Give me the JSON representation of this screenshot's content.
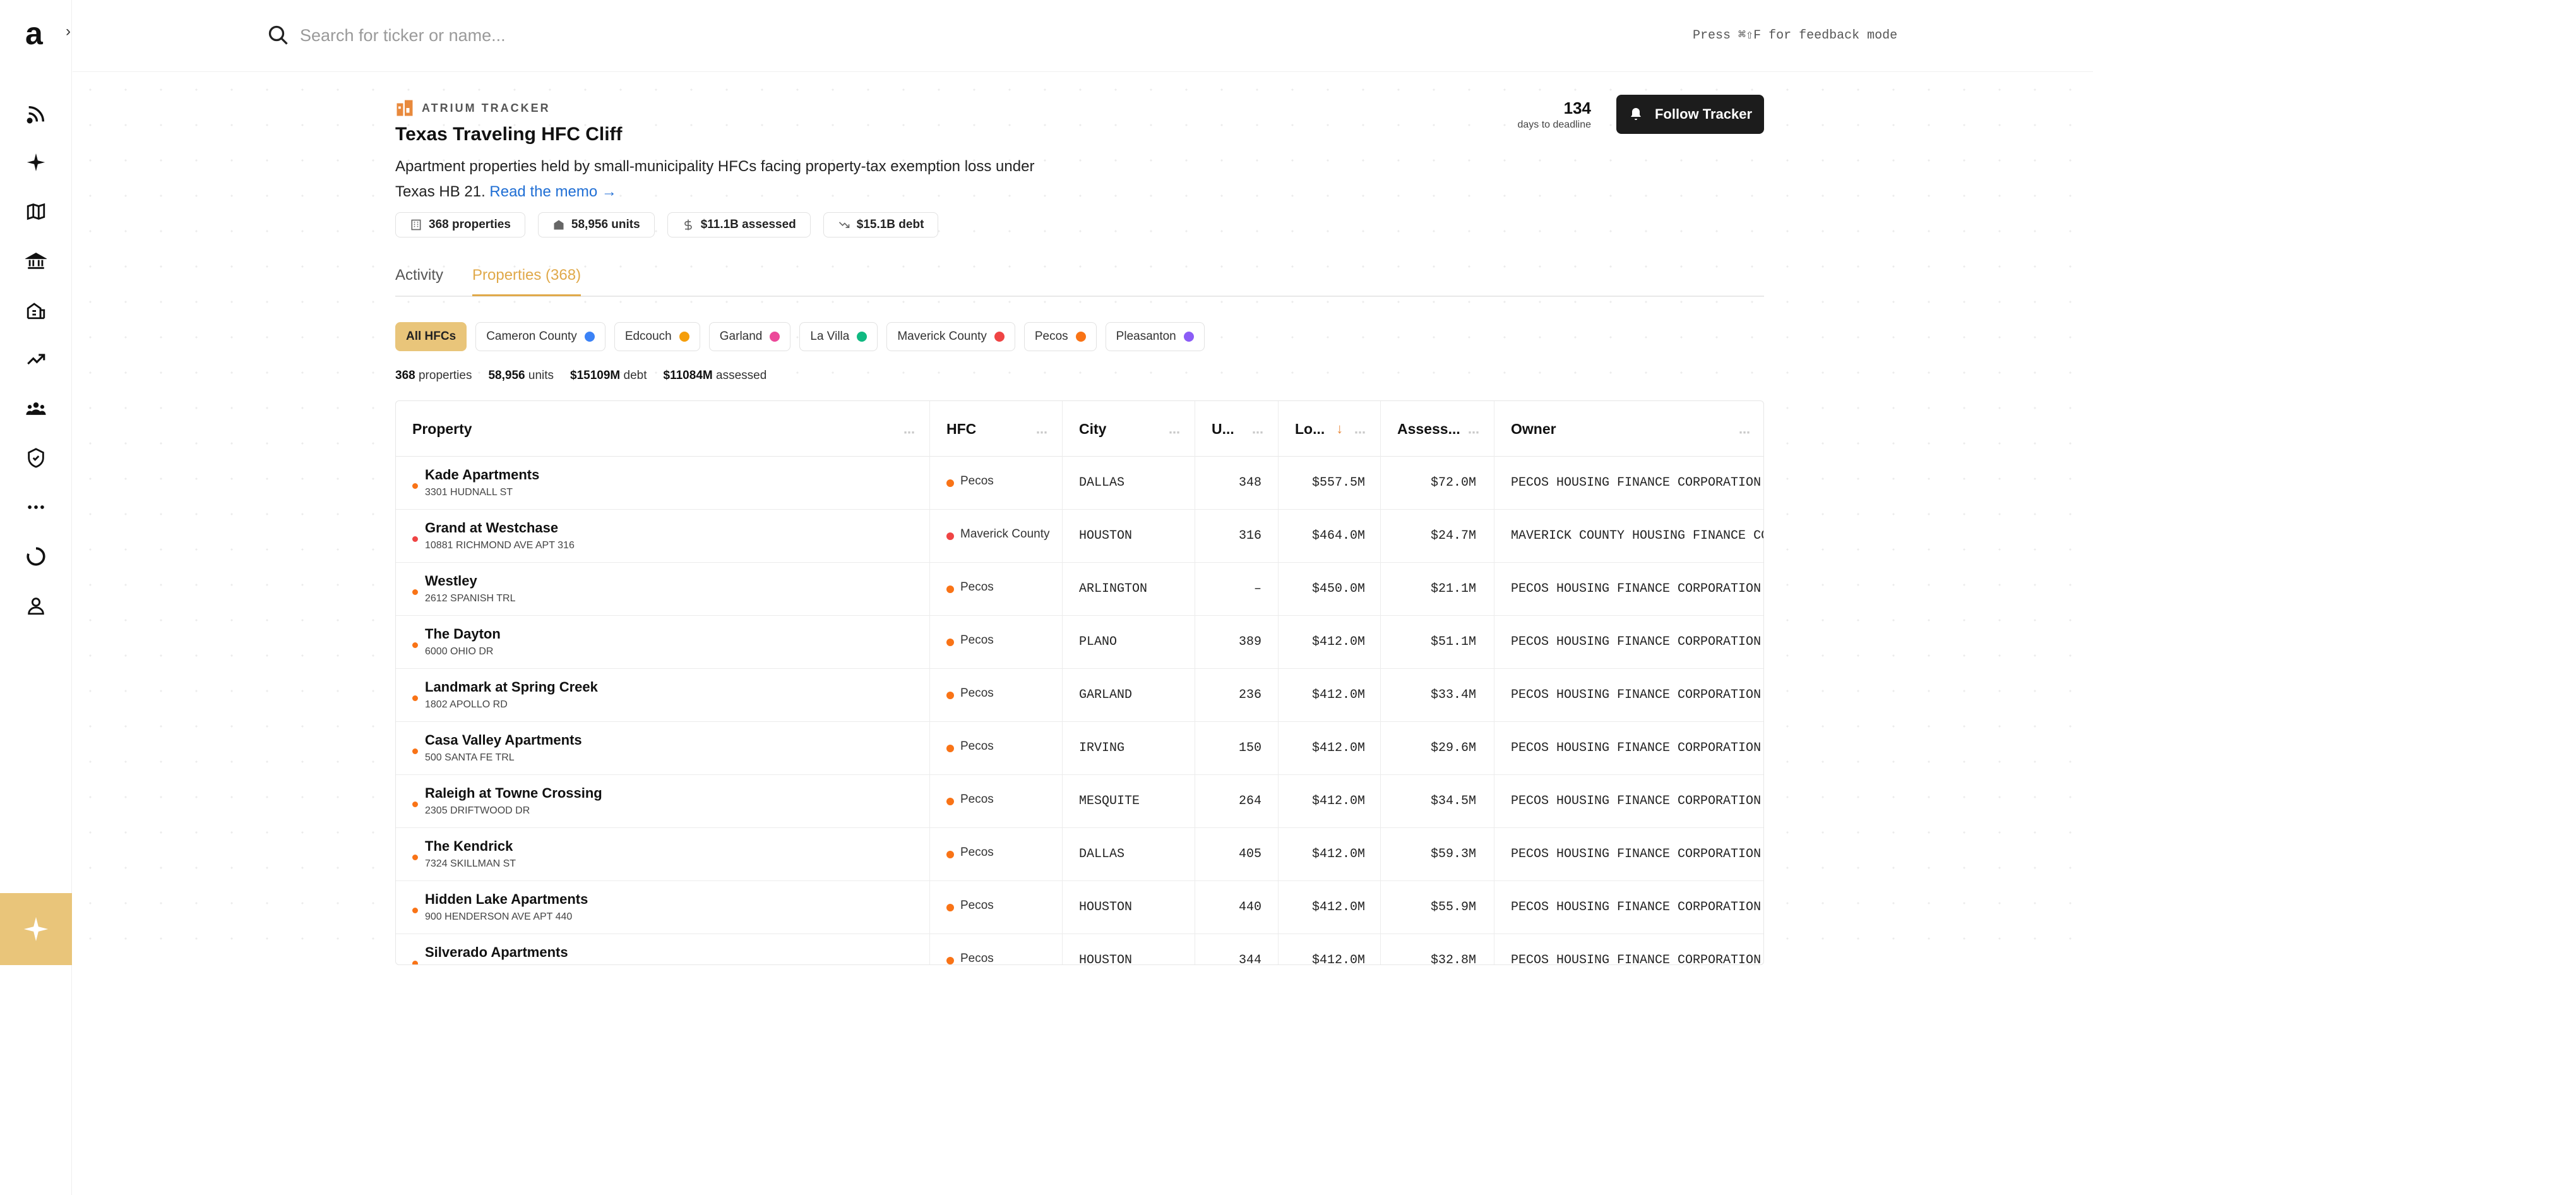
{
  "sidebar": {
    "logo": "a",
    "icons": [
      "rss-icon",
      "sparkle-icon",
      "map-icon",
      "bank-icon",
      "buildings-icon",
      "trending-icon",
      "users-icon",
      "shield-icon",
      "more-icon",
      "loading-icon",
      "user-icon"
    ]
  },
  "topbar": {
    "search_placeholder": "Search for ticker or name...",
    "feedback_hint": "Press ⌘⇧F for feedback mode"
  },
  "tracker": {
    "brand": "ATRIUM TRACKER",
    "title": "Texas Traveling HFC Cliff",
    "description": "Apartment properties held by small-municipality HFCs facing property-tax exemption loss under Texas HB 21.",
    "memo_link": "Read the memo →",
    "deadline_days": "134",
    "deadline_label": "days to deadline",
    "follow_label": "Follow Tracker",
    "stats": [
      "368 properties",
      "58,956 units",
      "$11.1B assessed",
      "$15.1B debt"
    ]
  },
  "tabs": [
    "Activity",
    "Properties (368)"
  ],
  "filters": [
    {
      "label": "All HFCs",
      "color": ""
    },
    {
      "label": "Cameron County",
      "color": "#3b82f6"
    },
    {
      "label": "Edcouch",
      "color": "#f59e0b"
    },
    {
      "label": "Garland",
      "color": "#ec4899"
    },
    {
      "label": "La Villa",
      "color": "#10b981"
    },
    {
      "label": "Maverick County",
      "color": "#ef4444"
    },
    {
      "label": "Pecos",
      "color": "#f97316"
    },
    {
      "label": "Pleasanton",
      "color": "#8b5cf6"
    }
  ],
  "summary": {
    "properties_num": "368",
    "properties_label": "properties",
    "units_num": "58,956",
    "units_label": "units",
    "debt_num": "$15109M",
    "debt_label": "debt",
    "assessed_num": "$11084M",
    "assessed_label": "assessed"
  },
  "table": {
    "headers": [
      "Property",
      "HFC",
      "City",
      "U...",
      "Lo...",
      "Assess...",
      "Owner"
    ],
    "rows": [
      {
        "name": "Kade Apartments",
        "address": "3301 HUDNALL ST",
        "hfc": "Pecos",
        "hfc_color": "#f97316",
        "city": "DALLAS",
        "units": "348",
        "loan": "$557.5M",
        "assessed": "$72.0M",
        "owner": "PECOS HOUSING FINANCE CORPORATION"
      },
      {
        "name": "Grand at Westchase",
        "address": "10881 RICHMOND AVE APT 316",
        "hfc": "Maverick County",
        "hfc_color": "#ef4444",
        "city": "HOUSTON",
        "units": "316",
        "loan": "$464.0M",
        "assessed": "$24.7M",
        "owner": "MAVERICK COUNTY HOUSING FINANCE CO"
      },
      {
        "name": "Westley",
        "address": "2612 SPANISH TRL",
        "hfc": "Pecos",
        "hfc_color": "#f97316",
        "city": "ARLINGTON",
        "units": "–",
        "loan": "$450.0M",
        "assessed": "$21.1M",
        "owner": "PECOS HOUSING FINANCE CORPORATION"
      },
      {
        "name": "The Dayton",
        "address": "6000 OHIO DR",
        "hfc": "Pecos",
        "hfc_color": "#f97316",
        "city": "PLANO",
        "units": "389",
        "loan": "$412.0M",
        "assessed": "$51.1M",
        "owner": "PECOS HOUSING FINANCE CORPORATION"
      },
      {
        "name": "Landmark at Spring Creek",
        "address": "1802 APOLLO RD",
        "hfc": "Pecos",
        "hfc_color": "#f97316",
        "city": "GARLAND",
        "units": "236",
        "loan": "$412.0M",
        "assessed": "$33.4M",
        "owner": "PECOS HOUSING FINANCE CORPORATION"
      },
      {
        "name": "Casa Valley Apartments",
        "address": "500 SANTA FE TRL",
        "hfc": "Pecos",
        "hfc_color": "#f97316",
        "city": "IRVING",
        "units": "150",
        "loan": "$412.0M",
        "assessed": "$29.6M",
        "owner": "PECOS HOUSING FINANCE CORPORATION"
      },
      {
        "name": "Raleigh at Towne Crossing",
        "address": "2305 DRIFTWOOD DR",
        "hfc": "Pecos",
        "hfc_color": "#f97316",
        "city": "MESQUITE",
        "units": "264",
        "loan": "$412.0M",
        "assessed": "$34.5M",
        "owner": "PECOS HOUSING FINANCE CORPORATION"
      },
      {
        "name": "The Kendrick",
        "address": "7324 SKILLMAN ST",
        "hfc": "Pecos",
        "hfc_color": "#f97316",
        "city": "DALLAS",
        "units": "405",
        "loan": "$412.0M",
        "assessed": "$59.3M",
        "owner": "PECOS HOUSING FINANCE CORPORATION"
      },
      {
        "name": "Hidden Lake Apartments",
        "address": "900 HENDERSON AVE APT 440",
        "hfc": "Pecos",
        "hfc_color": "#f97316",
        "city": "HOUSTON",
        "units": "440",
        "loan": "$412.0M",
        "assessed": "$55.9M",
        "owner": "PECOS HOUSING FINANCE CORPORATION"
      },
      {
        "name": "Silverado Apartments",
        "address": "",
        "hfc": "Pecos",
        "hfc_color": "#f97316",
        "city": "HOUSTON",
        "units": "344",
        "loan": "$412.0M",
        "assessed": "$32.8M",
        "owner": "PECOS HOUSING FINANCE CORPORATION"
      }
    ]
  },
  "colors": {
    "accent": "#e9c57a",
    "link": "#1f6ed4",
    "sort_arrow": "#e8893c"
  }
}
